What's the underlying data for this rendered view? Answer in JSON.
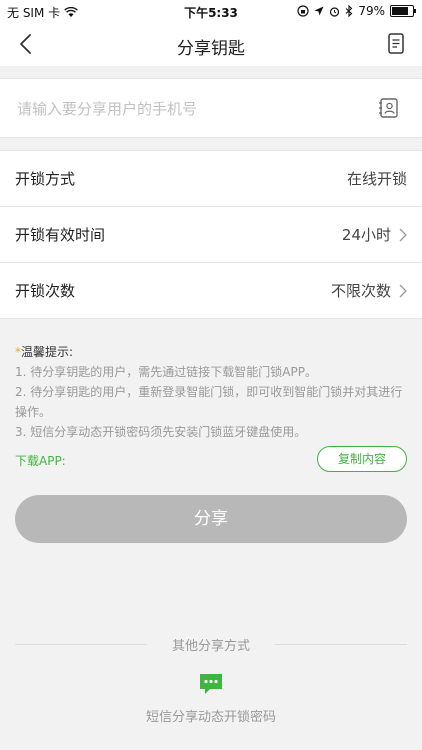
{
  "status_bar": {
    "carrier": "无 SIM 卡",
    "time": "下午5:33",
    "battery": "79%",
    "battery_level": 0.79
  },
  "nav": {
    "title": "分享钥匙"
  },
  "phone": {
    "value": "",
    "placeholder": "请输入要分享用户的手机号"
  },
  "settings": [
    {
      "label": "开锁方式",
      "value": "在线开锁",
      "has_chevron": false
    },
    {
      "label": "开锁有效时间",
      "value": "24小时",
      "has_chevron": true
    },
    {
      "label": "开锁次数",
      "value": "不限次数",
      "has_chevron": true
    }
  ],
  "tips": {
    "star": "*",
    "title": "温馨提示",
    "colon": ":",
    "items": [
      "1. 待分享钥匙的用户，需先通过链接下载智能门锁APP。",
      "2. 待分享钥匙的用户，重新登录智能门锁，即可收到智能门锁并对其进行操作。",
      "3. 短信分享动态开锁密码须先安装门锁蓝牙键盘使用。"
    ]
  },
  "download": {
    "label": "下载APP:",
    "copy_label": "复制内容"
  },
  "share_button": {
    "label": "分享"
  },
  "other": {
    "divider_text": "其他分享方式",
    "sms_label": "短信分享动态开锁密码"
  },
  "colors": {
    "accent_green": "#3fb53f",
    "disabled_gray": "#b8b8b8"
  }
}
